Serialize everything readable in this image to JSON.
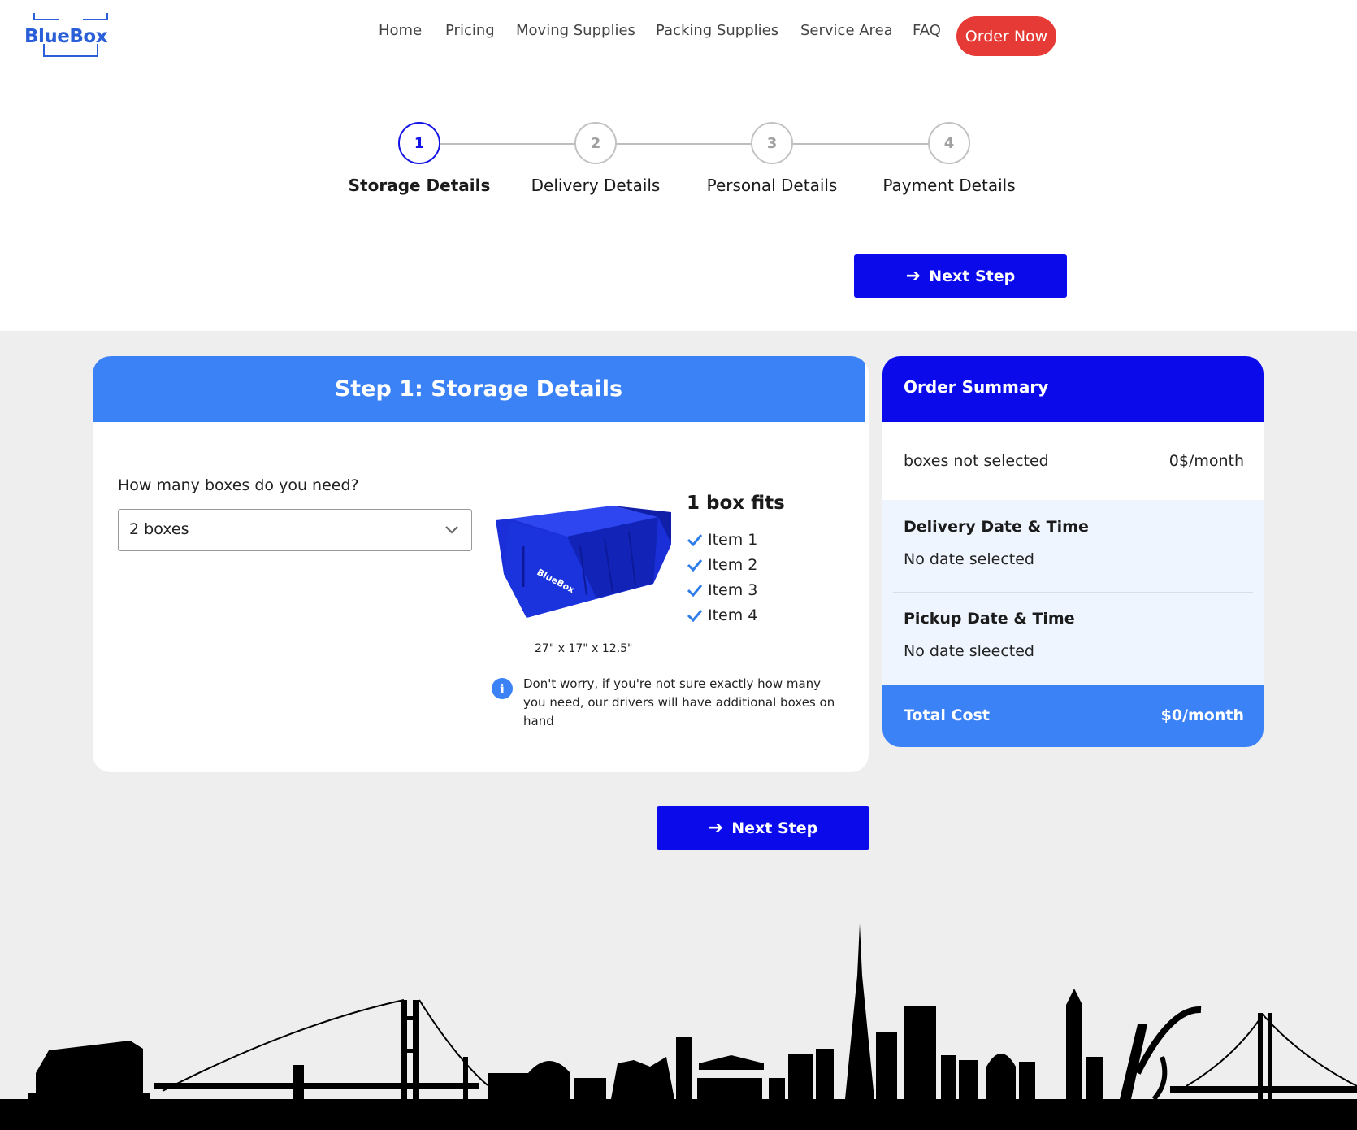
{
  "brand": {
    "logo_text": "BlueBox",
    "accent": "#0a0aeb",
    "light_accent": "#3b82f6",
    "cta_color": "#e53a35"
  },
  "nav": {
    "items": [
      "Home",
      "Pricing",
      "Moving Supplies",
      "Packing Supplies",
      "Service Area",
      "FAQ"
    ],
    "cta": "Order Now"
  },
  "stepper": {
    "steps": [
      {
        "number": "1",
        "label": "Storage Details",
        "active": true
      },
      {
        "number": "2",
        "label": "Delivery Details",
        "active": false
      },
      {
        "number": "3",
        "label": "Personal Details",
        "active": false
      },
      {
        "number": "4",
        "label": "Payment Details",
        "active": false
      }
    ]
  },
  "next_step_label": "Next Step",
  "storage": {
    "title": "Step 1: Storage Details",
    "question": "How many boxes do you need?",
    "selected_option": "2 boxes",
    "box_dimensions": "27\" x 17\" x 12.5\"",
    "box_logo_text": "BlueBox",
    "fits_title": "1 box fits",
    "fits_items": [
      "Item 1",
      "Item 2",
      "Item 3",
      "Item 4"
    ],
    "info_note": "Don't worry, if you're not sure exactly how many you need, our drivers will have additional boxes on hand"
  },
  "summary": {
    "title": "Order Summary",
    "boxes_label": "boxes not selected",
    "boxes_price": "0$/month",
    "delivery_title": "Delivery Date & Time",
    "delivery_value": "No date selected",
    "pickup_title": "Pickup Date & Time",
    "pickup_value": "No date sleected",
    "total_label": "Total Cost",
    "total_value": "$0/month"
  }
}
